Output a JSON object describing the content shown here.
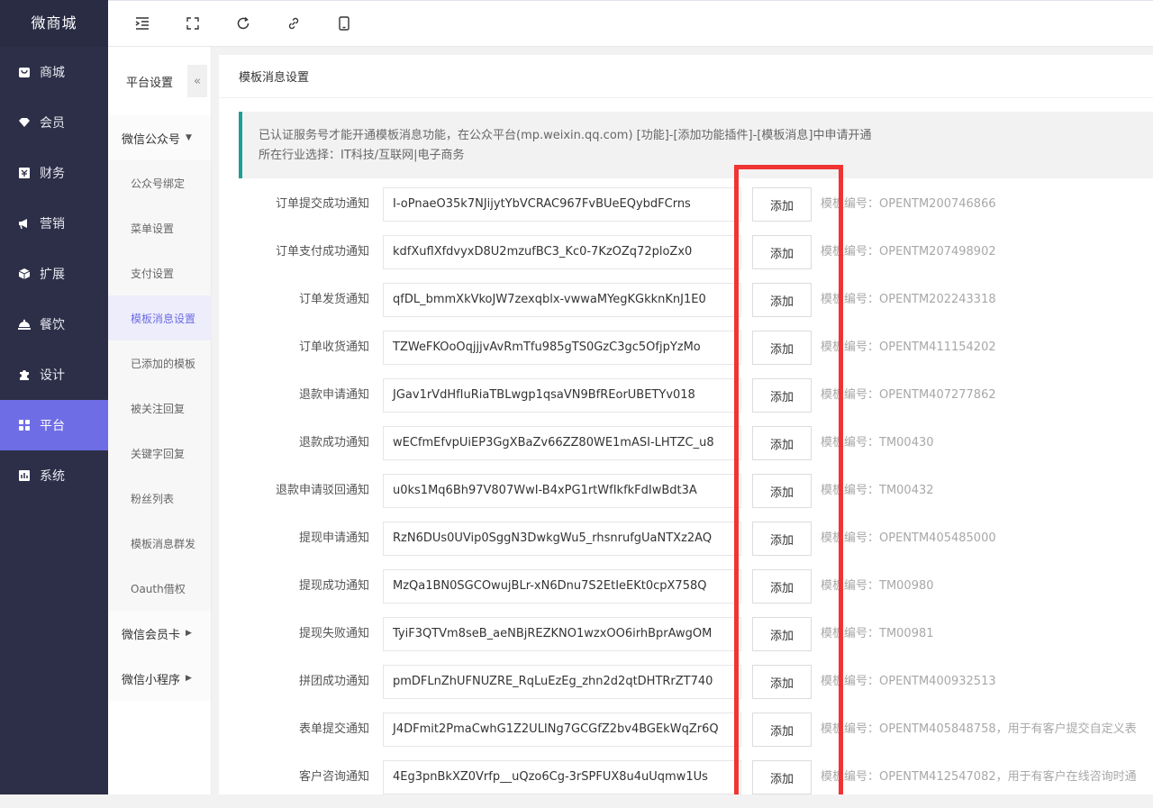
{
  "app": {
    "logo": "微商城"
  },
  "sidebar": {
    "items": [
      {
        "label": "商城",
        "icon": "shop-icon"
      },
      {
        "label": "会员",
        "icon": "diamond-icon"
      },
      {
        "label": "财务",
        "icon": "finance-icon"
      },
      {
        "label": "营销",
        "icon": "megaphone-icon"
      },
      {
        "label": "扩展",
        "icon": "cube-icon"
      },
      {
        "label": "餐饮",
        "icon": "dish-icon"
      },
      {
        "label": "设计",
        "icon": "puzzle-icon"
      },
      {
        "label": "平台",
        "icon": "grid-icon",
        "active": true
      },
      {
        "label": "系统",
        "icon": "system-icon"
      }
    ]
  },
  "topbar": {
    "buttons": [
      "menu-toggle-icon",
      "fullscreen-icon",
      "refresh-icon",
      "link-icon",
      "mobile-icon"
    ]
  },
  "subnav": {
    "title": "平台设置",
    "collapse": "«",
    "groups": [
      {
        "label": "微信公众号",
        "caret": "▼"
      },
      {
        "label": "微信会员卡",
        "caret": "▶"
      },
      {
        "label": "微信小程序",
        "caret": "▶"
      }
    ],
    "items": [
      "公众号绑定",
      "菜单设置",
      "支付设置",
      "模板消息设置",
      "已添加的模板",
      "被关注回复",
      "关键字回复",
      "粉丝列表",
      "模板消息群发",
      "Oauth借权"
    ],
    "active_index": 3
  },
  "main": {
    "title": "模板消息设置",
    "notice_line1": "已认证服务号才能开通模板消息功能，在公众平台(mp.weixin.qq.com) [功能]-[添加功能插件]-[模板消息]中申请开通",
    "notice_line2": "所在行业选择：IT科技/互联网|电子商务",
    "add_label": "添加",
    "rows": [
      {
        "label": "订单提交成功通知",
        "value": "I-oPnaeO35k7NJijytYbVCRAC967FvBUeEQybdFCrns",
        "code": "模板编号：OPENTM200746866"
      },
      {
        "label": "订单支付成功通知",
        "value": "kdfXuflXfdvyxD8U2mzufBC3_Kc0-7KzOZq72ploZx0",
        "code": "模板编号：OPENTM207498902"
      },
      {
        "label": "订单发货通知",
        "value": "qfDL_bmmXkVkoJW7zexqblx-vwwaMYegKGkknKnJ1E0",
        "code": "模板编号：OPENTM202243318"
      },
      {
        "label": "订单收货通知",
        "value": "TZWeFKOoOqjjjvAvRmTfu985gTS0GzC3gc5OfjpYzMo",
        "code": "模板编号：OPENTM411154202"
      },
      {
        "label": "退款申请通知",
        "value": "JGav1rVdHfIuRiaTBLwgp1qsaVN9BfREorUBETYv018",
        "code": "模板编号：OPENTM407277862"
      },
      {
        "label": "退款成功通知",
        "value": "wECfmEfvpUiEP3GgXBaZv66ZZ80WE1mASI-LHTZC_u8",
        "code": "模板编号：TM00430"
      },
      {
        "label": "退款申请驳回通知",
        "value": "u0ks1Mq6Bh97V807WwI-B4xPG1rtWfIkfkFdIwBdt3A",
        "code": "模板编号：TM00432"
      },
      {
        "label": "提现申请通知",
        "value": "RzN6DUs0UVip0SggN3DwkgWu5_rhsnrufgUaNTXz2AQ",
        "code": "模板编号：OPENTM405485000"
      },
      {
        "label": "提现成功通知",
        "value": "MzQa1BN0SGCOwujBLr-xN6Dnu7S2EtIeEKt0cpX758Q",
        "code": "模板编号：TM00980"
      },
      {
        "label": "提现失败通知",
        "value": "TyiF3QTVm8seB_aeNBjREZKNO1wzxOO6irhBprAwgOM",
        "code": "模板编号：TM00981"
      },
      {
        "label": "拼团成功通知",
        "value": "pmDFLnZhUFNUZRE_RqLuEzEg_zhn2d2qtDHTRrZT740",
        "code": "模板编号：OPENTM400932513"
      },
      {
        "label": "表单提交通知",
        "value": "J4DFmit2PmaCwhG1Z2ULINg7GCGfZ2bv4BGEkWqZr6Q",
        "code": "模板编号：OPENTM405848758，用于有客户提交自定义表"
      },
      {
        "label": "客户咨询通知",
        "value": "4Eg3pnBkXZ0Vrfp__uQzo6Cg-3rSPFUX8u4uUqmw1Us",
        "code": "模板编号：OPENTM412547082，用于有客户在线咨询时通"
      }
    ]
  },
  "colors": {
    "sidebar_bg": "#2d2f48",
    "accent": "#6e6de5",
    "notice_border": "#1aa094",
    "highlight_box": "#f03434"
  }
}
